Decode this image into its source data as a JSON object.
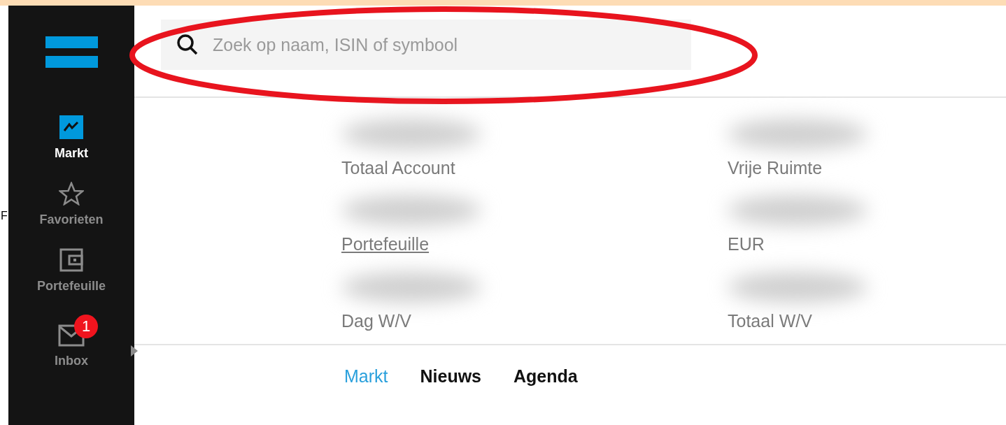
{
  "sidebar": {
    "items": [
      {
        "kind": "chart",
        "label": "Markt",
        "selected": true
      },
      {
        "kind": "star",
        "label": "Favorieten",
        "selected": false
      },
      {
        "kind": "wallet",
        "label": "Portefeuille",
        "selected": false
      },
      {
        "kind": "mail",
        "label": "Inbox",
        "selected": false,
        "badge": "1",
        "expandable": true
      }
    ]
  },
  "stray_text": "F",
  "search": {
    "placeholder": "Zoek op naam, ISIN of symbool",
    "circled": true
  },
  "summary": [
    {
      "label": "Totaal Account",
      "blurred": true,
      "link": false
    },
    {
      "label": "Vrije Ruimte",
      "blurred": true,
      "link": false
    },
    {
      "label": "Portefeuille",
      "blurred": true,
      "link": true
    },
    {
      "label": "EUR",
      "blurred": true,
      "link": false
    },
    {
      "label": "Dag W/V",
      "blurred": true,
      "link": false
    },
    {
      "label": "Totaal W/V",
      "blurred": true,
      "link": false
    }
  ],
  "tabs": [
    {
      "label": "Markt",
      "selected": true
    },
    {
      "label": "Nieuws",
      "selected": false
    },
    {
      "label": "Agenda",
      "selected": false
    }
  ]
}
